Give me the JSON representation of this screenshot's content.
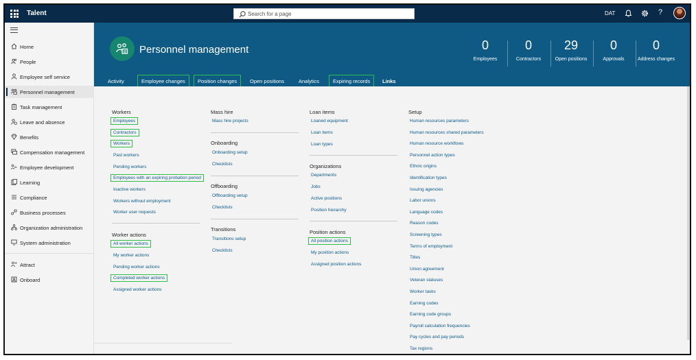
{
  "topbar": {
    "app_title": "Talent",
    "search_placeholder": "Search for a page",
    "company": "DAT",
    "help": "?"
  },
  "sidebar": {
    "items": [
      {
        "label": "Home",
        "icon": "home-icon"
      },
      {
        "label": "People",
        "icon": "people-icon"
      },
      {
        "label": "Employee self service",
        "icon": "person-icon"
      },
      {
        "label": "Personnel management",
        "icon": "org-chart-icon",
        "active": true
      },
      {
        "label": "Task management",
        "icon": "clipboard-icon"
      },
      {
        "label": "Leave and absence",
        "icon": "person-clock-icon"
      },
      {
        "label": "Benefits",
        "icon": "diamond-icon"
      },
      {
        "label": "Compensation management",
        "icon": "money-icon"
      },
      {
        "label": "Employee development",
        "icon": "growth-icon"
      },
      {
        "label": "Learning",
        "icon": "book-icon"
      },
      {
        "label": "Compliance",
        "icon": "list-icon"
      },
      {
        "label": "Business processes",
        "icon": "flow-icon"
      },
      {
        "label": "Organization administration",
        "icon": "org-icon"
      },
      {
        "label": "System administration",
        "icon": "monitor-icon"
      },
      {
        "label": "Attract",
        "icon": "attract-icon"
      },
      {
        "label": "Onboard",
        "icon": "onboard-icon"
      }
    ]
  },
  "header": {
    "title": "Personnel management",
    "kpis": [
      {
        "value": "0",
        "label": "Employees"
      },
      {
        "value": "0",
        "label": "Contractors"
      },
      {
        "value": "29",
        "label": "Open positions"
      },
      {
        "value": "0",
        "label": "Approvals"
      },
      {
        "value": "0",
        "label": "Address changes"
      }
    ],
    "tabs": [
      {
        "label": "Activity"
      },
      {
        "label": "Employee changes",
        "highlighted": true
      },
      {
        "label": "Position changes",
        "highlighted": true
      },
      {
        "label": "Open positions"
      },
      {
        "label": "Analytics"
      },
      {
        "label": "Expiring records",
        "highlighted": true
      },
      {
        "label": "Links",
        "selected": true
      }
    ]
  },
  "links": {
    "workers": {
      "title": "Workers",
      "items": [
        "Employees",
        "Contractors",
        "Workers",
        "Past workers",
        "Pending workers",
        "Employees with an expiring probation period",
        "Inactive workers",
        "Workers without employment",
        "Worker user requests"
      ]
    },
    "worker_actions": {
      "title": "Worker actions",
      "items": [
        "All worker actions",
        "My worker actions",
        "Pending worker actions",
        "Completed worker actions",
        "Assigned worker actions"
      ]
    },
    "mass_hire": {
      "title": "Mass hire",
      "items": [
        "Mass hire projects"
      ]
    },
    "onboarding": {
      "title": "Onboarding",
      "items": [
        "Onboarding setup",
        "Checklists"
      ]
    },
    "offboarding": {
      "title": "Offboarding",
      "items": [
        "Offboarding setup",
        "Checklists"
      ]
    },
    "transitions": {
      "title": "Transitions",
      "items": [
        "Transitions setup",
        "Checklists"
      ]
    },
    "loan_items": {
      "title": "Loan items",
      "items": [
        "Loaned equipment",
        "Loan items",
        "Loan types"
      ]
    },
    "organizations": {
      "title": "Organizations",
      "items": [
        "Departments",
        "Jobs",
        "Active positions",
        "Position hierarchy"
      ]
    },
    "position_actions": {
      "title": "Position actions",
      "items": [
        "All position actions",
        "My position actions",
        "Assigned position actions"
      ]
    },
    "setup": {
      "title": "Setup",
      "items": [
        "Human resources parameters",
        "Human resources shared parameters",
        "Human resource workflows",
        "Personnel action types",
        "Ethnic origins",
        "Identification types",
        "Issuing agencies",
        "Labor unions",
        "Language codes",
        "Reason codes",
        "Screening types",
        "Terms of employment",
        "Titles",
        "Union agreement",
        "Veteran statuses",
        "Worker tasks",
        "Earning codes",
        "Earning code groups",
        "Payroll calculation frequencies",
        "Pay cycles and pay periods",
        "Tax regions"
      ]
    }
  }
}
